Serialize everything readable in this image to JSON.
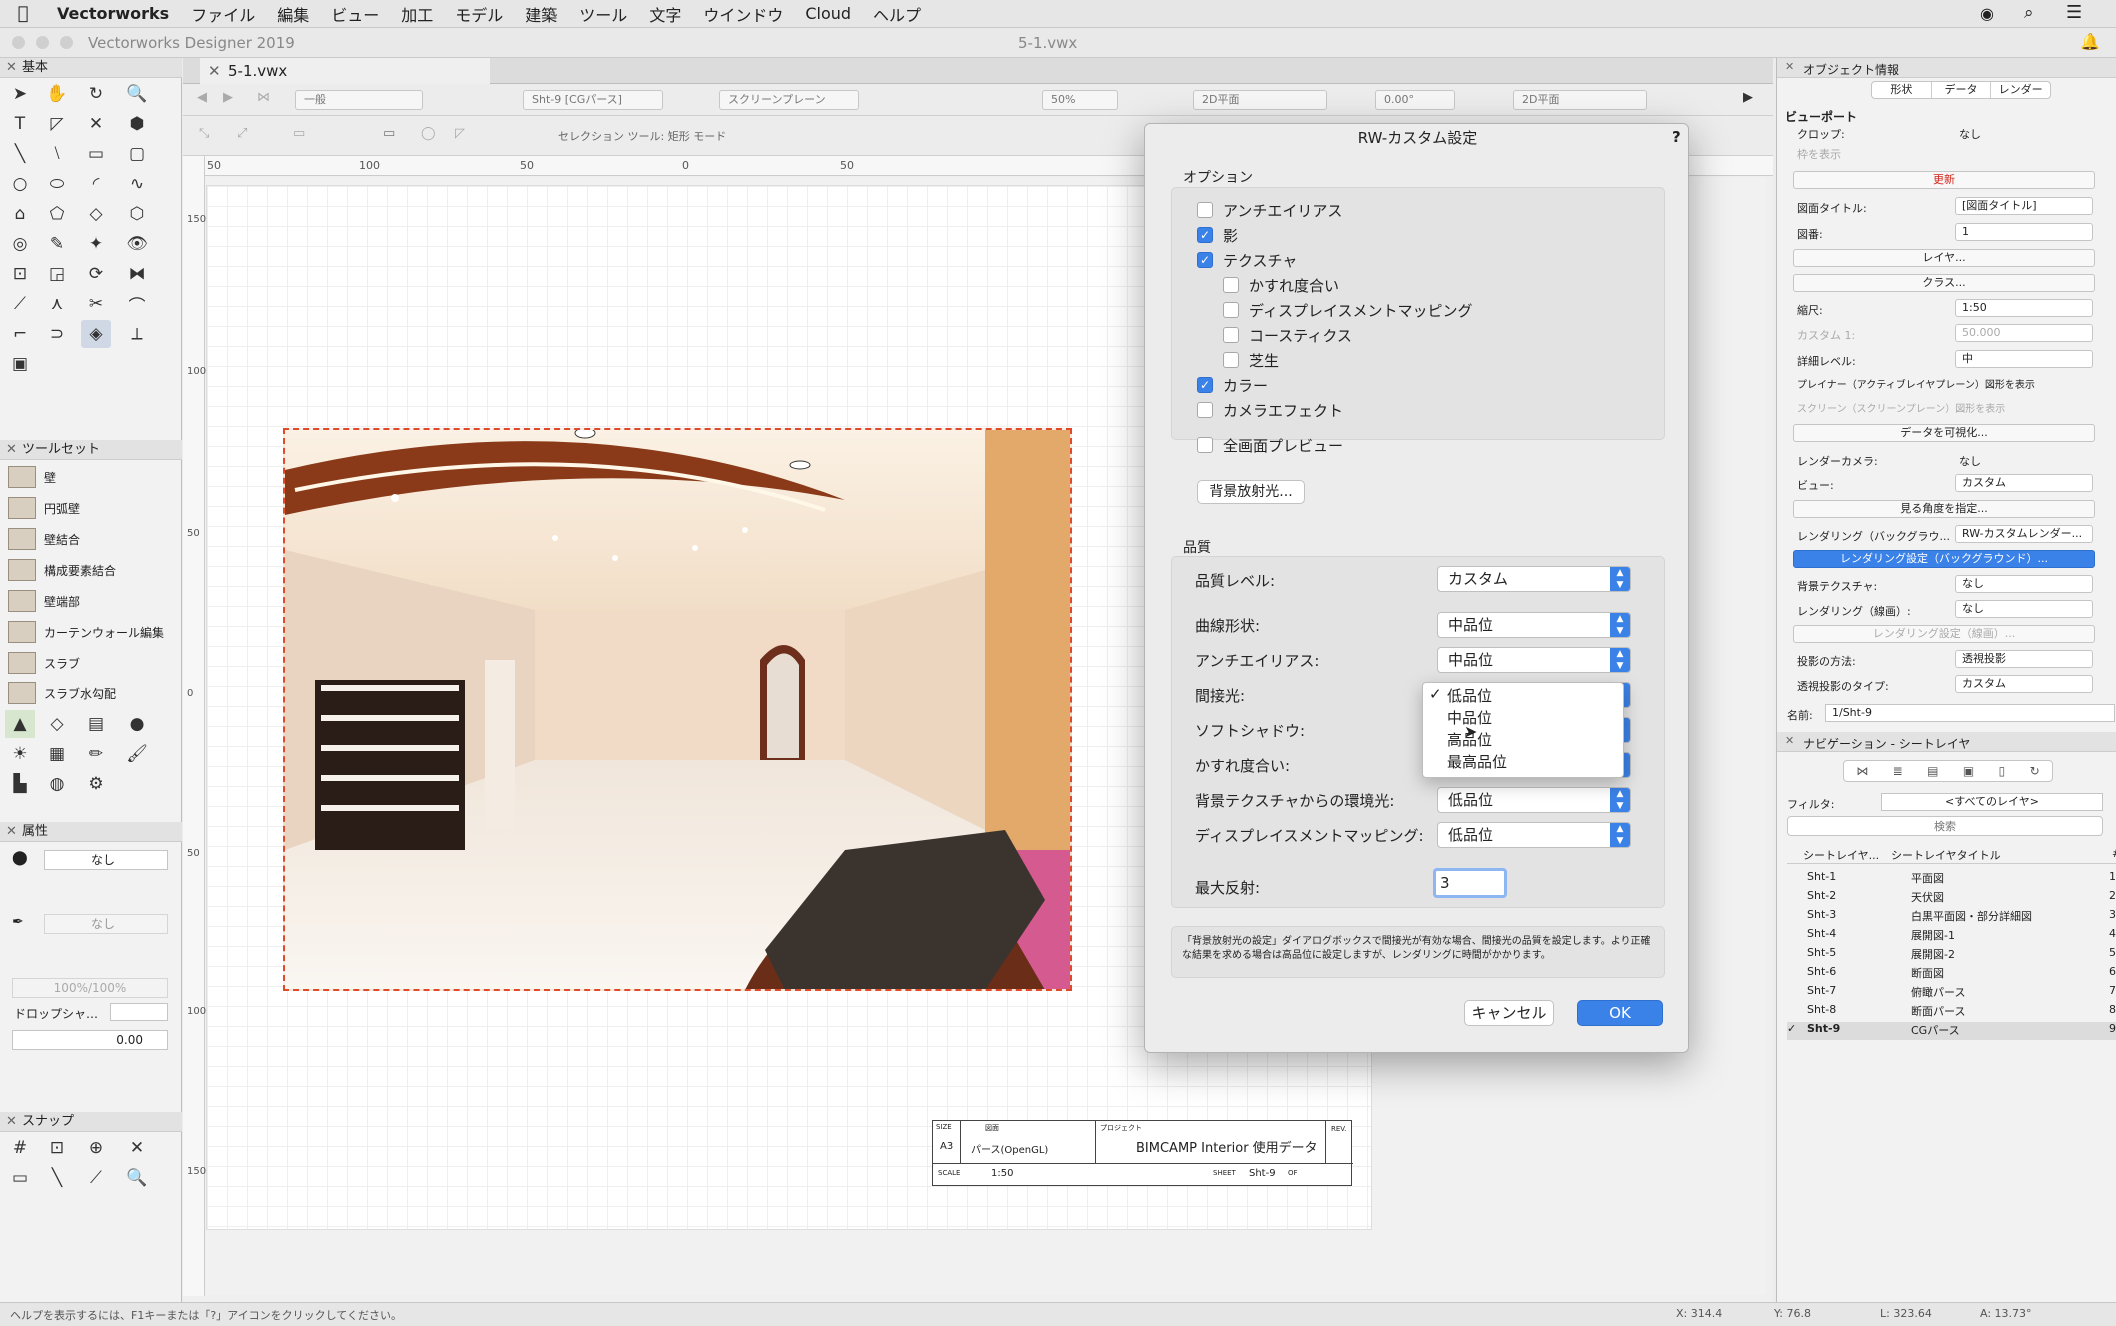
{
  "menubar": {
    "app": "Vectorworks",
    "items": [
      "ファイル",
      "編集",
      "ビュー",
      "加工",
      "モデル",
      "建築",
      "ツール",
      "文字",
      "ウインドウ",
      "Cloud",
      "ヘルプ"
    ]
  },
  "window": {
    "app_title": "Vectorworks Designer 2019",
    "doc_title": "5-1.vwx",
    "tab": "5-1.vwx"
  },
  "toolbar": {
    "class": "一般",
    "layer": "Sht-9 [CGパース]",
    "plane": "スクリーンプレーン",
    "zoom": "50%",
    "view": "2D平面",
    "angle": "0.00°",
    "render": "2D平面",
    "mode_label": "セレクション ツール: 矩形 モード"
  },
  "left": {
    "basic_title": "基本",
    "toolset_title": "ツールセット",
    "toolset_items": [
      "壁",
      "円弧壁",
      "壁結合",
      "構成要素結合",
      "壁端部",
      "カーテンウォール編集",
      "スラブ",
      "スラブ水勾配"
    ],
    "attr_title": "属性",
    "attr_fill": "なし",
    "attr_pen": "なし",
    "opacity": "100%/100%",
    "dropshadow": "ドロップシャ…",
    "lineval": "0.00",
    "snap_title": "スナップ"
  },
  "rulers": {
    "h": [
      "50",
      "100",
      "50",
      "0",
      "50"
    ],
    "v": [
      "150",
      "100",
      "50",
      "0",
      "50",
      "100",
      "150"
    ]
  },
  "titleblock": {
    "size_lbl": "SIZE",
    "size": "A3",
    "drawing_lbl": "図面",
    "drawing": "パース(OpenGL)",
    "project_lbl": "プロジェクト",
    "project": "BIMCAMP Interior 使用データ",
    "rev": "REV.",
    "scale_lbl": "SCALE",
    "scale": "1:50",
    "sheet_lbl": "SHEET",
    "sheet": "Sht-9",
    "of": "OF"
  },
  "dialog": {
    "title": "RW-カスタム設定",
    "help": "?",
    "options_label": "オプション",
    "options": [
      {
        "label": "アンチエイリアス",
        "checked": false
      },
      {
        "label": "影",
        "checked": true
      },
      {
        "label": "テクスチャ",
        "checked": true
      },
      {
        "label": "かすれ度合い",
        "checked": false
      },
      {
        "label": "ディスプレイスメントマッピング",
        "checked": false
      },
      {
        "label": "コースティクス",
        "checked": false
      },
      {
        "label": "芝生",
        "checked": false
      },
      {
        "label": "カラー",
        "checked": true
      },
      {
        "label": "カメラエフェクト",
        "checked": false
      },
      {
        "label": "全画面プレビュー",
        "checked": false
      }
    ],
    "bg_button": "背景放射光...",
    "quality_label": "品質",
    "quality_rows": [
      {
        "label": "品質レベル:",
        "value": "カスタム"
      },
      {
        "label": "曲線形状:",
        "value": "中品位"
      },
      {
        "label": "アンチエイリアス:",
        "value": "中品位"
      },
      {
        "label": "間接光:",
        "value": ""
      },
      {
        "label": "ソフトシャドウ:",
        "value": ""
      },
      {
        "label": "かすれ度合い:",
        "value": ""
      },
      {
        "label": "背景テクスチャからの環境光:",
        "value": "低品位"
      },
      {
        "label": "ディスプレイスメントマッピング:",
        "value": "低品位"
      }
    ],
    "max_reflect_label": "最大反射:",
    "max_reflect_value": "3",
    "dropdown": [
      "低品位",
      "中品位",
      "高品位",
      "最高品位"
    ],
    "dropdown_check": "✓",
    "note": "「背景放射光の設定」ダイアログボックスで間接光が有効な場合、間接光の品質を設定します。より正確な結果を求める場合は高品位に設定しますが、レンダリングに時間がかかります。",
    "cancel": "キャンセル",
    "ok": "OK"
  },
  "right": {
    "oi_title": "オブジェクト情報",
    "tabs": [
      "形状",
      "データ",
      "レンダー"
    ],
    "viewport_label": "ビューポート",
    "crop_lbl": "クロップ:",
    "crop_val": "なし",
    "frame_lbl": "枠を表示",
    "update_btn": "更新",
    "dwtitle_lbl": "図面タイトル:",
    "dwtitle_val": "[図面タイトル]",
    "dwnum_lbl": "図番:",
    "dwnum_val": "1",
    "layer_btn": "レイヤ...",
    "class_btn": "クラス...",
    "scale_lbl": "縮尺:",
    "scale_val": "1:50",
    "custom_lbl": "カスタム 1:",
    "custom_val": "50.000",
    "detail_lbl": "詳細レベル:",
    "detail_val": "中",
    "planar_lbl": "プレイナー（アクティブレイヤプレーン）図形を表示",
    "screen_lbl": "スクリーン（スクリーンプレーン）図形を表示",
    "visualize_btn": "データを可視化...",
    "rcam_lbl": "レンダーカメラ:",
    "rcam_val": "なし",
    "view_lbl": "ビュー:",
    "view_val": "カスタム",
    "angle_btn": "見る角度を指定...",
    "rbg_lbl": "レンダリング（バックグラウ...",
    "rbg_val": "RW-カスタムレンダー...",
    "rset_btn": "レンダリング設定（バックグラウンド）...",
    "bgtex_lbl": "背景テクスチャ:",
    "bgtex_val": "なし",
    "rline_lbl": "レンダリング（線画）:",
    "rline_val": "なし",
    "rline_btn": "レンダリング設定（線画）...",
    "proj_lbl": "投影の方法:",
    "proj_val": "透視投影",
    "persp_lbl": "透視投影のタイプ:",
    "persp_val": "カスタム",
    "name_lbl": "名前:",
    "name_val": "1/Sht-9",
    "nav_title": "ナビゲーション - シートレイヤ",
    "filter_lbl": "フィルタ:",
    "filter_val": "<すべてのレイヤ>",
    "search_ph": "検索",
    "col1": "シートレイヤ...",
    "col2": "シートレイヤタイトル",
    "col3": "#",
    "sheets": [
      {
        "id": "Sht-1",
        "title": "平面図",
        "n": "1"
      },
      {
        "id": "Sht-2",
        "title": "天伏図",
        "n": "2"
      },
      {
        "id": "Sht-3",
        "title": "白黒平面図・部分詳細図",
        "n": "3"
      },
      {
        "id": "Sht-4",
        "title": "展開図-1",
        "n": "4"
      },
      {
        "id": "Sht-5",
        "title": "展開図-2",
        "n": "5"
      },
      {
        "id": "Sht-6",
        "title": "断面図",
        "n": "6"
      },
      {
        "id": "Sht-7",
        "title": "俯瞰パース",
        "n": "7"
      },
      {
        "id": "Sht-8",
        "title": "断面パース",
        "n": "8"
      },
      {
        "id": "Sht-9",
        "title": "CGパース",
        "n": "9"
      }
    ],
    "active_check": "✓"
  },
  "status": {
    "help": "ヘルプを表示するには、F1キーまたは「?」アイコンをクリックしてください。",
    "x": "X: 314.4",
    "y": "Y: 76.8",
    "l": "L: 323.64",
    "a": "A: 13.73°"
  }
}
